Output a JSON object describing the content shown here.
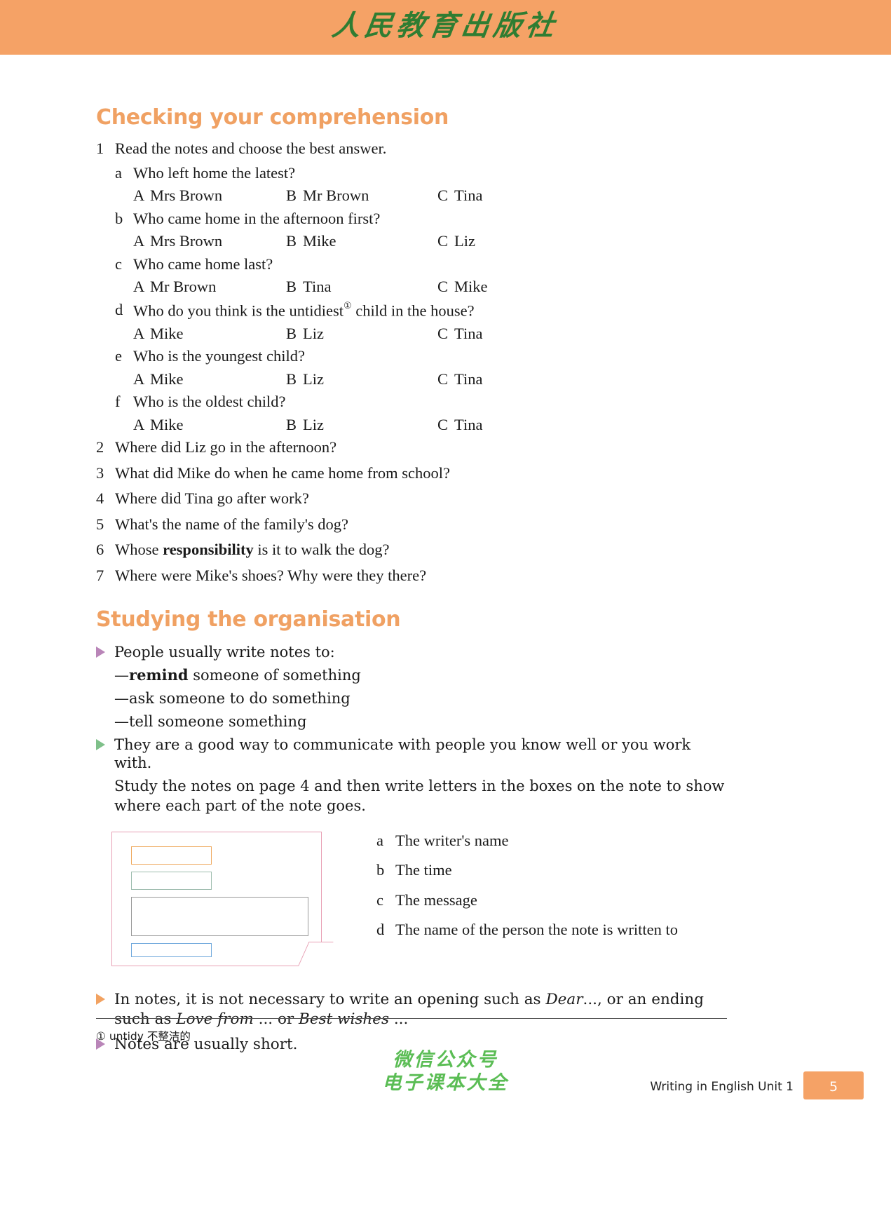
{
  "banner": {
    "publisher_logo": "人民教育出版社"
  },
  "sections": {
    "comprehension": {
      "heading": "Checking your comprehension",
      "item1": {
        "number": "1",
        "prompt": "Read the notes and choose the best answer.",
        "subquestions": [
          {
            "label": "a",
            "text": "Who left home the latest?",
            "options": [
              {
                "letter": "A",
                "value": "Mrs Brown"
              },
              {
                "letter": "B",
                "value": "Mr Brown"
              },
              {
                "letter": "C",
                "value": "Tina"
              }
            ]
          },
          {
            "label": "b",
            "text": "Who came home in the afternoon first?",
            "options": [
              {
                "letter": "A",
                "value": "Mrs Brown"
              },
              {
                "letter": "B",
                "value": "Mike"
              },
              {
                "letter": "C",
                "value": "Liz"
              }
            ]
          },
          {
            "label": "c",
            "text": "Who came home last?",
            "options": [
              {
                "letter": "A",
                "value": "Mr Brown"
              },
              {
                "letter": "B",
                "value": "Tina"
              },
              {
                "letter": "C",
                "value": "Mike"
              }
            ]
          },
          {
            "label": "d",
            "text_before": "Who do you think is the untidiest",
            "footnote_marker": "①",
            "text_after": " child in the house?",
            "options": [
              {
                "letter": "A",
                "value": "Mike"
              },
              {
                "letter": "B",
                "value": "Liz"
              },
              {
                "letter": "C",
                "value": "Tina"
              }
            ]
          },
          {
            "label": "e",
            "text": "Who is the youngest child?",
            "options": [
              {
                "letter": "A",
                "value": "Mike"
              },
              {
                "letter": "B",
                "value": "Liz"
              },
              {
                "letter": "C",
                "value": "Tina"
              }
            ]
          },
          {
            "label": "f",
            "text": "Who is the oldest child?",
            "options": [
              {
                "letter": "A",
                "value": "Mike"
              },
              {
                "letter": "B",
                "value": "Liz"
              },
              {
                "letter": "C",
                "value": "Tina"
              }
            ]
          }
        ]
      },
      "questions": [
        {
          "number": "2",
          "text": "Where did Liz go in the afternoon?"
        },
        {
          "number": "3",
          "text": "What did Mike do when he came home from school?"
        },
        {
          "number": "4",
          "text": "Where did Tina go after work?"
        },
        {
          "number": "5",
          "text": "What's the name of the family's dog?"
        },
        {
          "number": "6",
          "text_before": "Whose ",
          "bold": "responsibility",
          "text_after": " is it to walk the dog?"
        },
        {
          "number": "7",
          "text": "Where were Mike's shoes? Why were they there?"
        }
      ]
    },
    "organisation": {
      "heading": "Studying the organisation",
      "bullet1": {
        "arrow_color": "#b985b8",
        "text": "People usually write notes to:"
      },
      "dashes": [
        {
          "dash": "—",
          "bold": "remind",
          "rest": " someone of something"
        },
        {
          "dash": "—",
          "bold": "",
          "rest": "ask someone to do something"
        },
        {
          "dash": "—",
          "bold": "",
          "rest": "tell someone something"
        }
      ],
      "bullet2": {
        "arrow_color": "#7fc08a",
        "text": "They are a good way to communicate with people you know well or you work with."
      },
      "instruction": "Study the notes on page 4 and then write letters in the boxes on the note to show where each part of the note goes.",
      "note_diagram": {
        "boxes": [
          {
            "name": "time-box",
            "color": "#efa95e"
          },
          {
            "name": "recipient-box",
            "color": "#9dbcae"
          },
          {
            "name": "message-box",
            "color": "#9a9a9a"
          },
          {
            "name": "writer-box",
            "color": "#6fa8dc"
          }
        ],
        "border_color": "#e8a0b4"
      },
      "labels": [
        {
          "label": "a",
          "text": "The writer's name"
        },
        {
          "label": "b",
          "text": "The time"
        },
        {
          "label": "c",
          "text": "The message"
        },
        {
          "label": "d",
          "text": "The name of the person the note is written to"
        }
      ],
      "closing": [
        {
          "arrow_color": "#f2a261",
          "part1": "In notes, it is not necessary to write an opening such as ",
          "italic1": "Dear",
          "part2": "..., or an ending such as ",
          "italic2": "Love from",
          "part3": " ... or ",
          "italic3": "Best wishes",
          "part4": " ..."
        },
        {
          "arrow_color": "#b985b8",
          "text": "Notes are usually short."
        }
      ]
    }
  },
  "footnote": {
    "marker": "①",
    "term": "untidy",
    "translation": "不整洁的"
  },
  "watermark": {
    "line1": "微信公众号",
    "line2": "电子课本大全"
  },
  "footer": {
    "unit_label": "Writing in English Unit 1",
    "page_number": "5",
    "accent_color": "#f5a266"
  }
}
